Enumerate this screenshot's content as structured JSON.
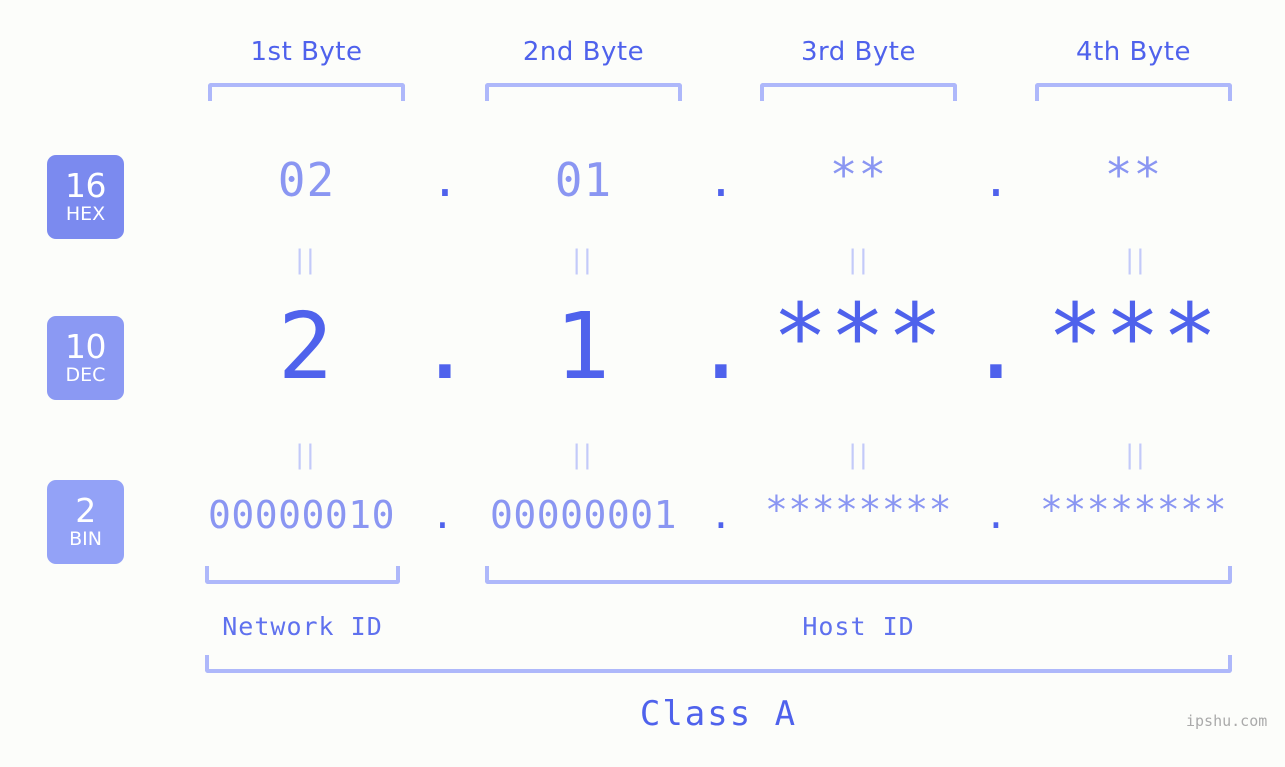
{
  "meta": {
    "background_color": "#fcfdfa",
    "accent_strong": "#4f62ec",
    "accent_mid": "#8a96f2",
    "accent_light": "#aeb8fa",
    "watermark": "ipshu.com"
  },
  "byte_headers": [
    {
      "label": "1st Byte"
    },
    {
      "label": "2nd Byte"
    },
    {
      "label": "3rd Byte"
    },
    {
      "label": "4th Byte"
    }
  ],
  "bases": [
    {
      "number": "16",
      "name": "HEX",
      "color": "#7b8aef"
    },
    {
      "number": "10",
      "name": "DEC",
      "color": "#8b99f3"
    },
    {
      "number": "2",
      "name": "BIN",
      "color": "#93a2f7"
    }
  ],
  "rows": {
    "hex": {
      "base_number": "16",
      "base_name": "HEX",
      "values": [
        "02",
        "01",
        "**",
        "**"
      ],
      "separators": [
        ".",
        ".",
        "."
      ]
    },
    "dec": {
      "base_number": "10",
      "base_name": "DEC",
      "values": [
        "2",
        "1",
        "***",
        "***"
      ],
      "separators": [
        ".",
        ".",
        "."
      ]
    },
    "bin": {
      "base_number": "2",
      "base_name": "BIN",
      "values": [
        "00000010",
        "00000001",
        "********",
        "********"
      ],
      "separators": [
        ".",
        ".",
        "."
      ]
    }
  },
  "connectors": {
    "symbol": "||",
    "rows": 2,
    "columns": 4
  },
  "id_labels": [
    {
      "label": "Network ID"
    },
    {
      "label": "Host ID"
    }
  ],
  "class_label": "Class A"
}
